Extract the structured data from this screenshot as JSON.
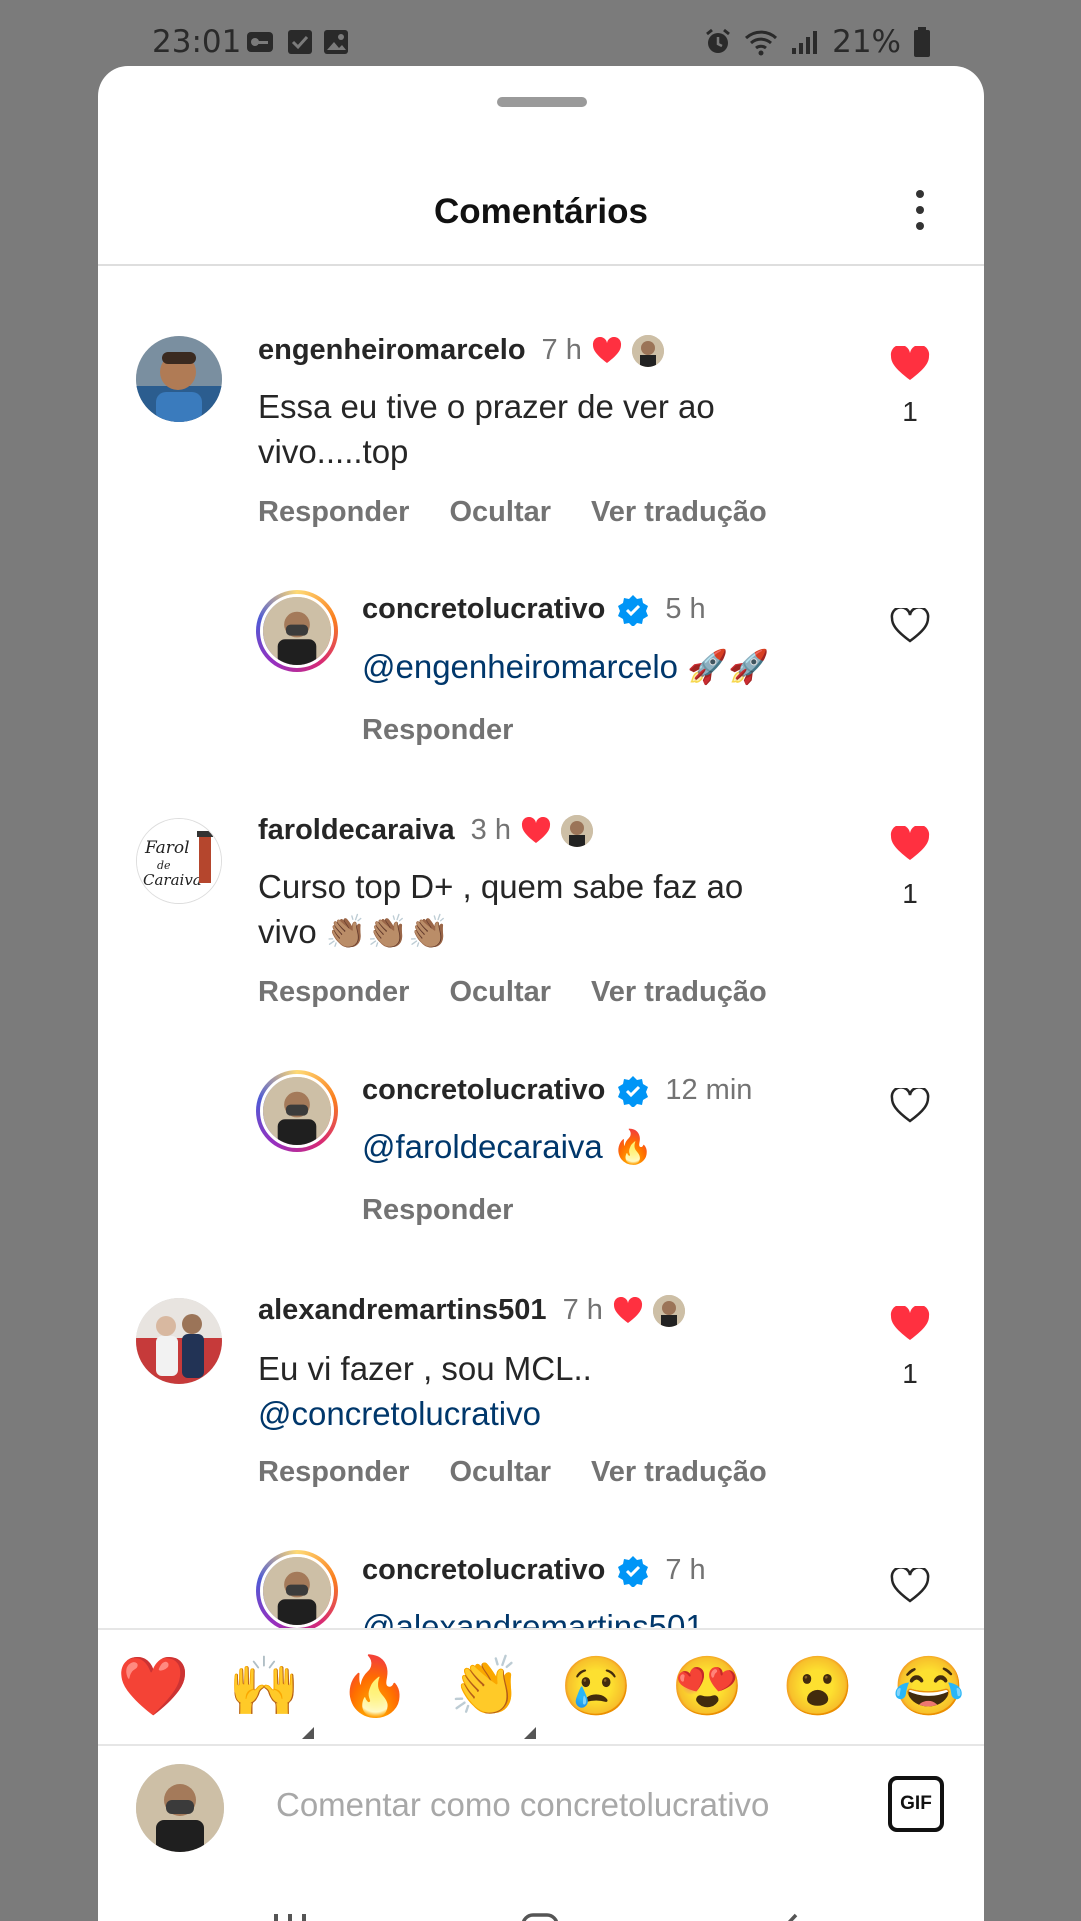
{
  "status": {
    "time": "23:01",
    "battery": "21%"
  },
  "sheet": {
    "title": "Comentários"
  },
  "comments": [
    {
      "username": "engenheiromarcelo",
      "time": "7 h",
      "text": "Essa eu tive o prazer de  ver ao vivo.....top",
      "actions": [
        "Responder",
        "Ocultar",
        "Ver tradução"
      ],
      "likes": "1",
      "liked": true
    },
    {
      "username": "concretolucrativo",
      "time": "5 h",
      "mention": "@engenheiromarcelo",
      "emoji": "🚀🚀",
      "reply_label": "Responder"
    },
    {
      "username": "faroldecaraiva",
      "time": "3 h",
      "text_line1": "Curso top D+ , quem sabe faz ao",
      "text_line2": "vivo",
      "emoji": "👏🏽👏🏽👏🏽",
      "actions": [
        "Responder",
        "Ocultar",
        "Ver tradução"
      ],
      "likes": "1",
      "liked": true
    },
    {
      "username": "concretolucrativo",
      "time": "12 min",
      "mention": "@faroldecaraiva",
      "emoji": "🔥",
      "reply_label": "Responder"
    },
    {
      "username": "alexandremartins501",
      "time": "7 h",
      "text": "Eu vi fazer , sou MCL..",
      "mention": "@concretolucrativo",
      "actions": [
        "Responder",
        "Ocultar",
        "Ver tradução"
      ],
      "likes": "1",
      "liked": true
    },
    {
      "username": "concretolucrativo",
      "time": "7 h",
      "mention": "@alexandremartins501"
    }
  ],
  "emoji_bar": [
    "❤️",
    "🙌",
    "🔥",
    "👏",
    "😢",
    "😍",
    "😮",
    "😂"
  ],
  "composer": {
    "placeholder": "Comentar como concretolucrativo",
    "gif_label": "GIF"
  },
  "colors": {
    "like_red": "#ff3040",
    "verified_blue": "#0095f6",
    "mention": "#00376b"
  }
}
